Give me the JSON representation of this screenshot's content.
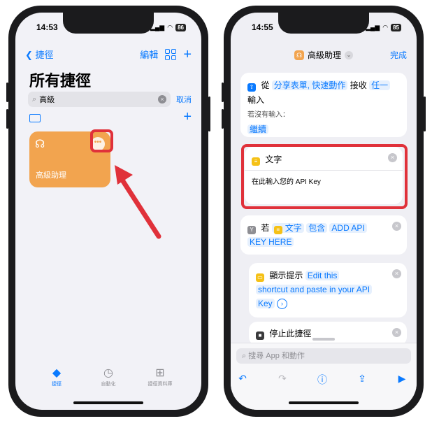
{
  "left_phone": {
    "status": {
      "time": "14:53",
      "battery": "86"
    },
    "nav": {
      "back_label": "捷徑",
      "edit_label": "編輯"
    },
    "page_title": "所有捷徑",
    "search": {
      "value": "高級",
      "cancel_label": "取消"
    },
    "shortcut_tile": {
      "name": "高級助理",
      "color": "#f2a44f"
    },
    "tabs": [
      {
        "label": "捷徑",
        "icon": "layers-icon",
        "active": true
      },
      {
        "label": "自動化",
        "icon": "clock-icon",
        "active": false
      },
      {
        "label": "捷徑資料庫",
        "icon": "gallery-plus-icon",
        "active": false
      }
    ],
    "annotation_color": "#e0313a"
  },
  "right_phone": {
    "status": {
      "time": "14:55",
      "battery": "85"
    },
    "nav": {
      "title": "高級助理",
      "done_label": "完成"
    },
    "receive_action": {
      "from_label": "從",
      "source_token": "分享表單, 快速動作",
      "receive_label": "接收",
      "input_token": "任一",
      "input_label": "輸入",
      "if_no_input_label": "若沒有輸入：",
      "fallback_token": "繼續"
    },
    "text_action": {
      "title": "文字",
      "content": "在此輸入您的 API Key"
    },
    "if_action": {
      "if_label": "若",
      "var_token": "文字",
      "condition_token": "包含",
      "value_token_line1": "ADD API",
      "value_token_line2": "KEY HERE"
    },
    "alert_action": {
      "title": "顯示提示",
      "msg_line1": "Edit this",
      "msg_line2": "shortcut and paste in your API",
      "msg_line3": "Key"
    },
    "stop_action": {
      "title": "停止此捷徑"
    },
    "bottom": {
      "search_placeholder": "搜尋 App 和動作"
    }
  }
}
